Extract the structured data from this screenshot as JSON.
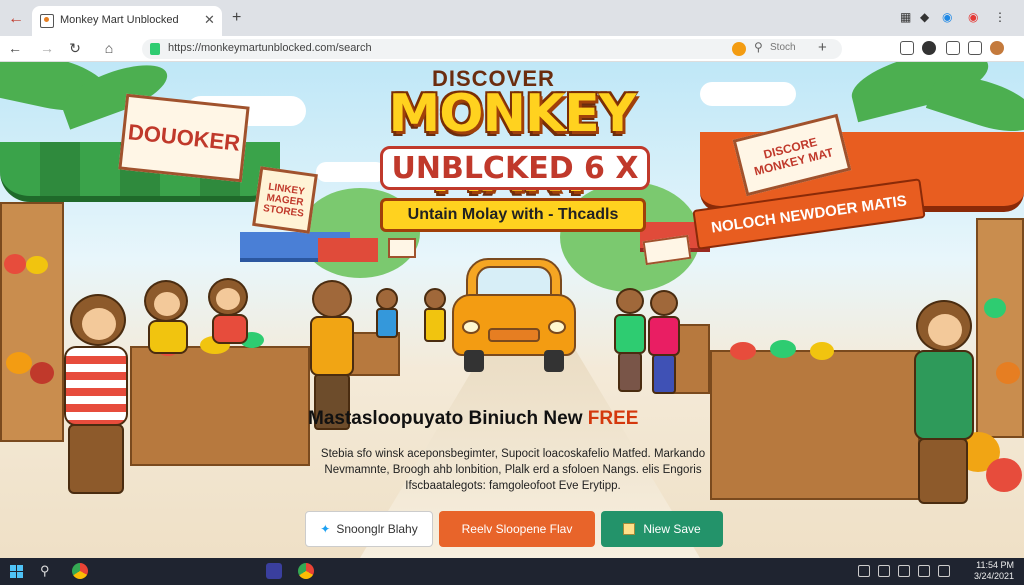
{
  "browser": {
    "tab_title": "Monkey Mart Unblocked",
    "url": "https://monkeymartunblocked.com/search",
    "search_label": "Stoch"
  },
  "hero": {
    "discover": "DISCOVER",
    "title": "MONKEY MART",
    "badge": "UNBLCKED 6 X",
    "ribbon": "Untain Molay with - Thcadls"
  },
  "stall_signs": {
    "left": "DOUOKER",
    "left_small": "LINKEY MAGER STORES",
    "right": "DISCORE MONKEY MAT",
    "right_banner": "NOLOCH NEWDOER MATIS"
  },
  "content": {
    "tagline": "Mastasloopuyato Biniuch New",
    "tagline_accent": "FREE",
    "description": "Stebia sfo winsk aceponsbegimter, Supocit loacoskafelio Matfed. Markando Nevmamnte, Broogh ahb lonbition, Plalk erd a sfoloen Nangs. elis Engoris Ifscbaatalegots: famgoleofoot Eve Erytipp."
  },
  "buttons": {
    "twitter": "Snoonglr Blahy",
    "play": "Reelv Sloopene Flav",
    "new": "Niew Save"
  },
  "colors": {
    "title_yellow": "#ffd21f",
    "title_outline": "#7a2e05",
    "play_button": "#e8642a",
    "new_button": "#23936a",
    "free_text": "#d4380d"
  },
  "taskbar": {
    "clock_time": "11:54 PM",
    "clock_date": "3/24/2021"
  }
}
